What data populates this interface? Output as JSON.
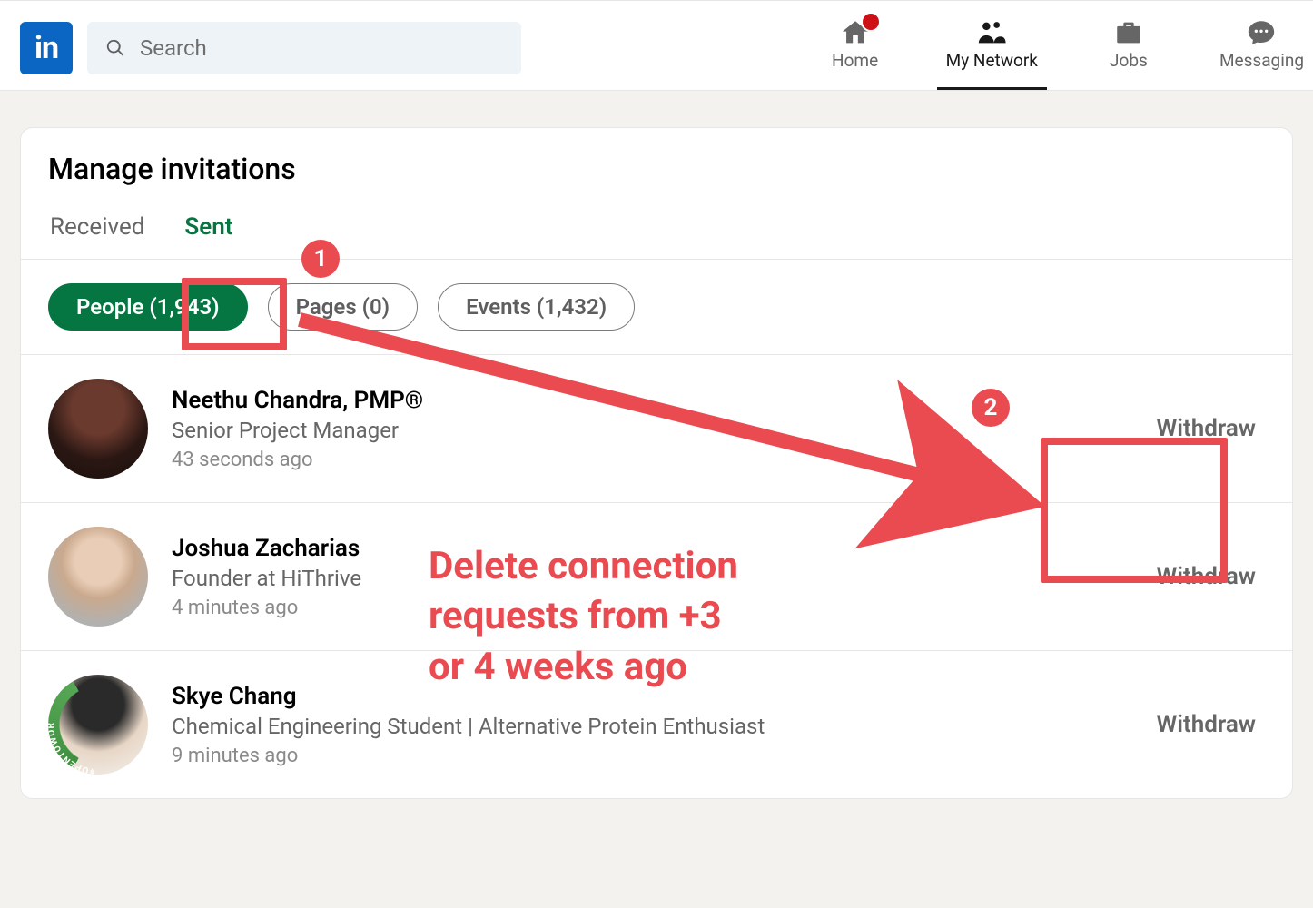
{
  "header": {
    "search_placeholder": "Search",
    "nav": {
      "home": "Home",
      "network": "My Network",
      "jobs": "Jobs",
      "messaging": "Messaging"
    }
  },
  "page": {
    "title": "Manage invitations",
    "tabs": {
      "received": "Received",
      "sent": "Sent"
    },
    "filters": {
      "people": "People (1,943)",
      "pages": "Pages (0)",
      "events": "Events (1,432)"
    },
    "withdraw_label": "Withdraw",
    "rows": [
      {
        "name": "Neethu Chandra, PMP®",
        "headline": "Senior Project Manager",
        "time": "43 seconds ago"
      },
      {
        "name": "Joshua Zacharias",
        "headline": "Founder at HiThrive",
        "time": "4 minutes ago"
      },
      {
        "name": "Skye Chang",
        "headline": "Chemical Engineering Student | Alternative Protein Enthusiast",
        "time": "9 minutes ago"
      }
    ]
  },
  "annotation": {
    "step1": "1",
    "step2": "2",
    "text_l1": "Delete connection",
    "text_l2": "requests from +3",
    "text_l3": "or 4 weeks ago"
  }
}
